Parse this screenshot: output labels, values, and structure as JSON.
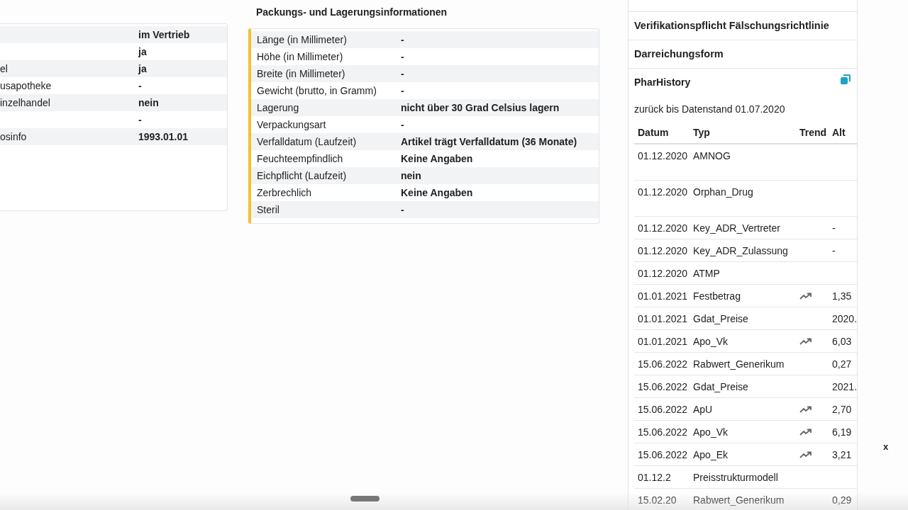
{
  "left_table": {
    "rows": [
      {
        "value": "im Vertrieb"
      },
      {
        "value": "ja"
      },
      {
        "label": "el",
        "value": "ja"
      },
      {
        "label": "usapotheke",
        "value": "-"
      },
      {
        "label": "inzelhandel",
        "value": "nein"
      },
      {
        "value": "-"
      },
      {
        "label": "osinfo",
        "value": "1993.01.01"
      }
    ]
  },
  "packaging": {
    "title": "Packungs- und Lagerungsinformationen",
    "rows": [
      {
        "label": "Länge (in Millimeter)",
        "value": "-"
      },
      {
        "label": "Höhe (in Millimeter)",
        "value": "-"
      },
      {
        "label": "Breite (in Millimeter)",
        "value": "-"
      },
      {
        "label": "Gewicht (brutto, in Gramm)",
        "value": "-"
      },
      {
        "label": "Lagerung",
        "value": "nicht über 30 Grad Celsius lagern"
      },
      {
        "label": "Verpackungsart",
        "value": "-"
      },
      {
        "label": "Verfalldatum (Laufzeit)",
        "value": "Artikel trägt Verfalldatum (36 Monate)"
      },
      {
        "label": "Feuchteempfindlich",
        "value": "Keine Angaben"
      },
      {
        "label": "Eichpflicht (Laufzeit)",
        "value": "nein"
      },
      {
        "label": "Zerbrechlich",
        "value": "Keine Angaben"
      },
      {
        "label": "Steril",
        "value": "-"
      }
    ]
  },
  "sidebar": {
    "sections": [
      "Verifikationspflicht Fälschungsrichtlinie",
      "Darreichungsform"
    ],
    "history": {
      "title": "PharHistory",
      "subtitle": "zurück bis Datenstand 01.07.2020",
      "columns": [
        "Datum",
        "Typ",
        "Trend",
        "Alt"
      ],
      "rows": [
        {
          "date": "01.12.2020",
          "type": "AMNOG",
          "trend": false,
          "tall": true
        },
        {
          "date": "01.12.2020",
          "type": "Orphan_Drug",
          "trend": false,
          "tall": true
        },
        {
          "date": "01.12.2020",
          "type": "Key_ADR_Vertreter",
          "trend": false,
          "alt": "-"
        },
        {
          "date": "01.12.2020",
          "type": "Key_ADR_Zulassung",
          "trend": false,
          "alt": "-"
        },
        {
          "date": "01.12.2020",
          "type": "ATMP",
          "trend": false
        },
        {
          "date": "01.01.2021",
          "type": "Festbetrag",
          "trend": true,
          "alt": "1,35"
        },
        {
          "date": "01.01.2021",
          "type": "Gdat_Preise",
          "trend": false,
          "alt": "2020."
        },
        {
          "date": "01.01.2021",
          "type": "Apo_Vk",
          "trend": true,
          "alt": "6,03"
        },
        {
          "date": "15.06.2022",
          "type": "Rabwert_Generikum",
          "trend": false,
          "alt": "0,27"
        },
        {
          "date": "15.06.2022",
          "type": "Gdat_Preise",
          "trend": false,
          "alt": "2021."
        },
        {
          "date": "15.06.2022",
          "type": "ApU",
          "trend": true,
          "alt": "2,70"
        },
        {
          "date": "15.06.2022",
          "type": "Apo_Vk",
          "trend": true,
          "alt": "6,19"
        },
        {
          "date": "15.06.2022",
          "type": "Apo_Ek",
          "trend": true,
          "alt": "3,21"
        },
        {
          "date": "01.12.2",
          "type": "Preisstrukturmodell",
          "trend": false
        },
        {
          "date": "15.02.20",
          "type": "Rabwert_Generikum",
          "trend": false,
          "alt": "0,29"
        }
      ]
    }
  },
  "close_label": "x"
}
